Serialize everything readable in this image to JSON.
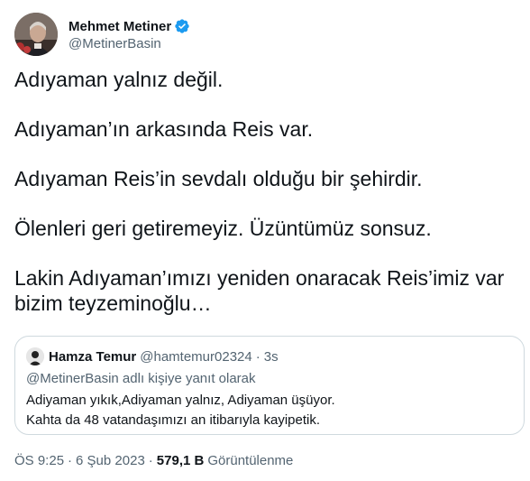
{
  "author": {
    "display_name": "Mehmet Metiner",
    "handle": "@MetinerBasin",
    "verified_color": "#1d9bf0"
  },
  "tweet": {
    "paragraphs": [
      "Adıyaman yalnız değil.",
      "Adıyaman’ın arkasında Reis var.",
      "Adıyaman Reis’in sevdalı olduğu bir şehirdir.",
      "Ölenleri geri getiremeyiz. Üzüntümüz sonsuz.",
      "Lakin Adıyaman’ımızı yeniden onaracak Reis’imiz var bizim teyzeminoğlu…"
    ]
  },
  "quoted": {
    "display_name": "Hamza Temur",
    "handle": "@hamtemur02324",
    "dot": "·",
    "time": "3s",
    "reply_context": "@MetinerBasin adlı kişiye yanıt olarak",
    "lines": [
      "Adiyaman yıkık,Adiyaman yalnız, Adiyaman üşüyor.",
      "Kahta da 48 vatandaşımızı an itibarıyla kayipetik."
    ]
  },
  "meta": {
    "time": "ÖS 9:25",
    "dot": "·",
    "date": "6 Şub 2023",
    "views_count": "579,1 B",
    "views_label": "Görüntülenme"
  },
  "icons": {
    "verified": "verified-badge-icon"
  }
}
